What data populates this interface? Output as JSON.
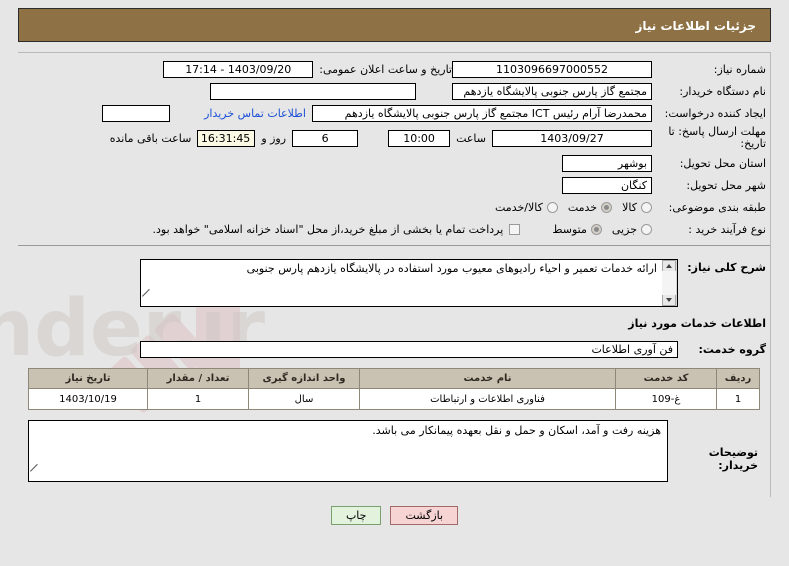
{
  "header": {
    "title": "جزئیات اطلاعات نیاز"
  },
  "top_section": {
    "need_number_label": "شماره نیاز:",
    "need_number_value": "1103096697000552",
    "announce_label": "تاریخ و ساعت اعلان عمومی:",
    "announce_value": "1403/09/20 - 17:14",
    "buyer_org_label": "نام دستگاه خریدار:",
    "buyer_org_value": "مجتمع گاز پارس جنوبی  پالایشگاه یازدهم",
    "requester_label": "ایجاد کننده درخواست:",
    "requester_value": "محمدرضا آرام رئیس ICT مجتمع گاز پارس جنوبی  پالایشگاه یازدهم",
    "buyer_contact_link": "اطلاعات تماس خریدار",
    "deadline_label": "مهلت ارسال پاسخ: تا تاریخ:",
    "deadline_date": "1403/09/27",
    "deadline_hour_label": "ساعت",
    "deadline_hour": "10:00",
    "remaining_days": "6",
    "remaining_days_label": "روز و",
    "remaining_time": "16:31:45",
    "remaining_suffix_label": "ساعت باقی مانده",
    "province_label": "استان محل تحویل:",
    "province_value": "بوشهر",
    "city_label": "شهر محل تحویل:",
    "city_value": "کنگان",
    "category_label": "طبقه بندی موضوعی:",
    "category_options": [
      {
        "label": "کالا",
        "selected": false
      },
      {
        "label": "خدمت",
        "selected": true
      },
      {
        "label": "کالا/خدمت",
        "selected": false
      }
    ],
    "process_label": "نوع فرآیند خرید :",
    "process_options": [
      {
        "label": "جزیی",
        "selected": false
      },
      {
        "label": "متوسط",
        "selected": true
      }
    ],
    "treasury_checkbox_checked": false,
    "treasury_note": "پرداخت تمام یا بخشی از مبلغ خرید،از محل \"اسناد خزانه اسلامی\" خواهد بود."
  },
  "description": {
    "label": "شرح کلی نیاز:",
    "text": "ارائه خدمات تعمیر و احیاء رادیوهای معیوب مورد استفاده در پالایشگاه یازدهم پارس جنوبی"
  },
  "services_section": {
    "heading": "اطلاعات خدمات مورد نیاز",
    "group_label": "گروه خدمت:",
    "group_value": "فن آوری اطلاعات"
  },
  "items_table": {
    "columns": [
      "ردیف",
      "کد خدمت",
      "نام خدمت",
      "واحد اندازه گیری",
      "تعداد / مقدار",
      "تاریخ نیاز"
    ],
    "rows": [
      [
        "1",
        "غ-109",
        "فناوری اطلاعات و ارتباطات",
        "سال",
        "1",
        "1403/10/19"
      ]
    ]
  },
  "buyer_notes": {
    "label": "توضیحات خریدار:",
    "text": "هزینه رفت و آمد، اسکان و حمل و نقل بعهده پیمانکار می باشد."
  },
  "footer": {
    "back_label": "بازگشت",
    "print_label": "چاپ"
  },
  "watermark": {
    "text": "AriaTender.ir"
  },
  "colors": {
    "header_bar": "#8e7245",
    "page_bg": "#e6e6e6",
    "link": "#1a4fd6",
    "table_header": "#c9c2b2",
    "back_button": "#f7d4d4",
    "print_button": "#e2f2dd"
  }
}
